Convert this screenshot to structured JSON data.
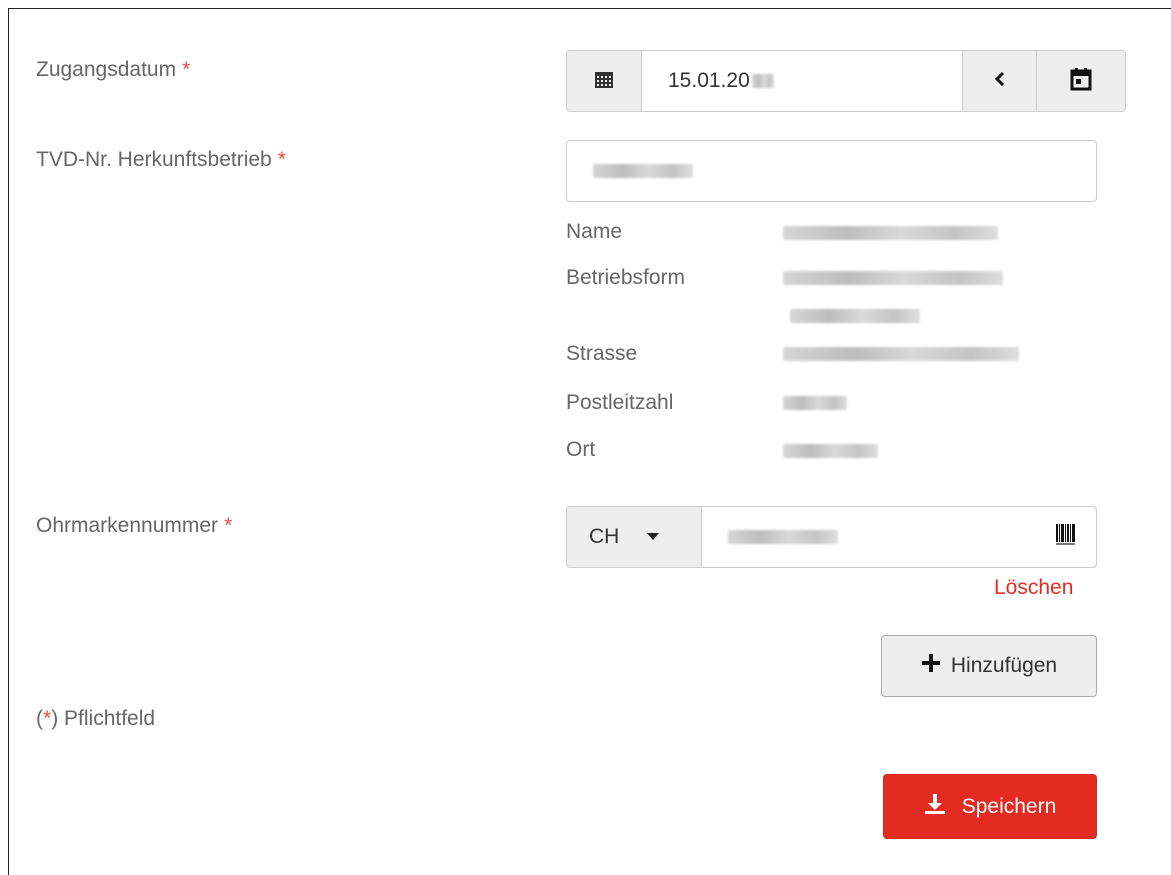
{
  "fields": {
    "zugangsdatum": {
      "label": "Zugangsdatum",
      "required_mark": "*",
      "value": "15.01.20"
    },
    "tvd": {
      "label": "TVD-Nr. Herkunftsbetrieb",
      "required_mark": "*"
    },
    "ohrmarke": {
      "label": "Ohrmarkennummer",
      "required_mark": "*",
      "country": "CH"
    }
  },
  "details": {
    "name_label": "Name",
    "betriebsform_label": "Betriebsform",
    "strasse_label": "Strasse",
    "plz_label": "Postleitzahl",
    "ort_label": "Ort"
  },
  "actions": {
    "delete_label": "Löschen",
    "add_label": "Hinzufügen",
    "save_label": "Speichern"
  },
  "footnote": {
    "prefix": "(",
    "mark": "*",
    "text": ") Pflichtfeld"
  },
  "colors": {
    "accent_red": "#e32b22",
    "required_red": "#e74c3c",
    "addon_bg": "#eeeeee",
    "border": "#cccccc"
  },
  "icons": {
    "calendar_left": "calendar-icon",
    "back": "chevron-left-icon",
    "calendar_right": "calendar-icon",
    "dropdown": "caret-down-icon",
    "barcode": "barcode-icon",
    "add": "plus-icon",
    "save": "download-icon"
  }
}
